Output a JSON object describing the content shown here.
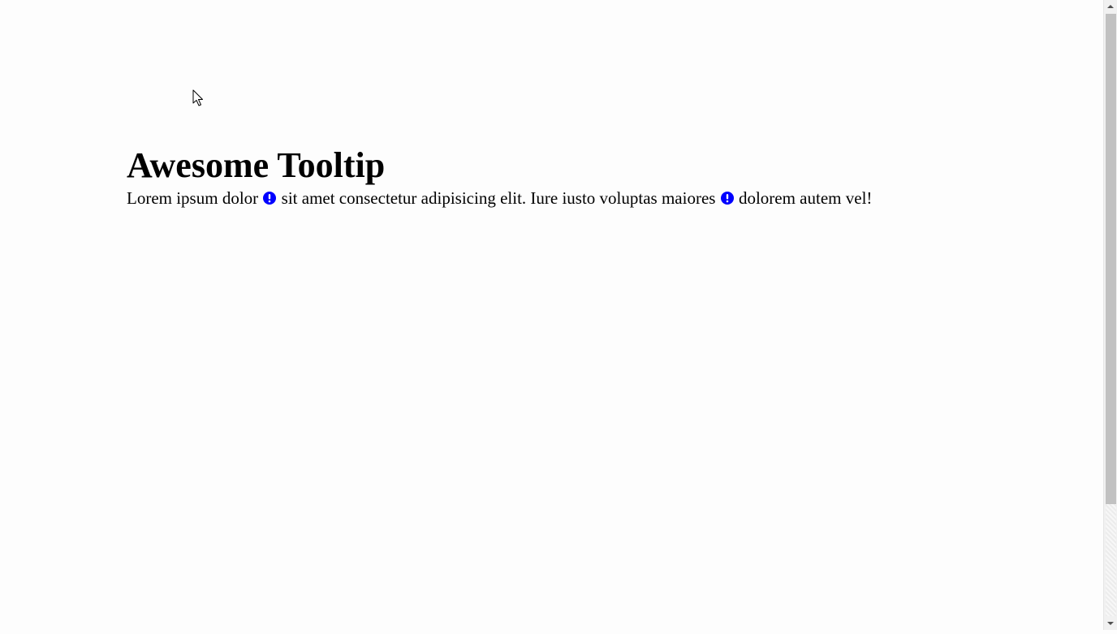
{
  "page": {
    "heading": "Awesome Tooltip",
    "paragraph": {
      "segment_1": "Lorem ipsum dolor",
      "segment_2": "sit amet consectetur adipisicing elit. Iure iusto voluptas maiores",
      "segment_3": "dolorem autem vel!"
    }
  },
  "icons": {
    "tooltip_trigger_1": "exclamation-circle-icon",
    "tooltip_trigger_2": "exclamation-circle-icon",
    "cursor": "mouse-pointer-icon"
  },
  "colors": {
    "background": "#fdfdfd",
    "text": "#000000",
    "icon": "#0000ff",
    "scrollbar_thumb": "#c1c1c1"
  }
}
